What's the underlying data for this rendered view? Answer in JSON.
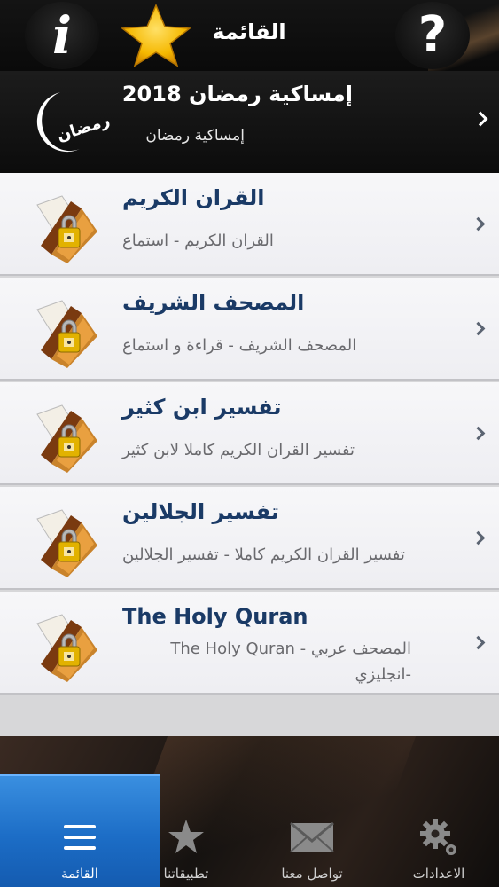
{
  "header": {
    "title": "القائمة",
    "info_icon_glyph": "i",
    "help_icon_glyph": "?",
    "star_color": "#f5b800"
  },
  "featured": {
    "title": "إمساكية رمضان 2018",
    "subtitle": "إمساكية رمضان",
    "icon": "ramadan-moon-icon",
    "icon_text": "رمضان"
  },
  "list": {
    "items": [
      {
        "title": "القران الكريم",
        "description": "القران الكريم - استماع",
        "icon": "locked-book-icon"
      },
      {
        "title": "المصحف الشريف",
        "description": "المصحف الشريف - قراءة و استماع",
        "icon": "locked-book-icon"
      },
      {
        "title": "تفسير ابن كثير",
        "description": "تفسير القران الكريم كاملا لابن كثير",
        "icon": "locked-book-icon"
      },
      {
        "title": "تفسير الجلالين",
        "description": "تفسير القران الكريم كاملا - تفسير الجلالين",
        "icon": "locked-book-icon"
      },
      {
        "title": "The Holy Quran",
        "description": "المصحف عربي - The Holy Quran -انجليزي",
        "icon": "locked-book-icon"
      }
    ]
  },
  "tabbar": {
    "tabs": [
      {
        "label": "القائمة",
        "icon": "menu-icon",
        "active": true
      },
      {
        "label": "تطبيقاتنا",
        "icon": "star-icon",
        "active": false
      },
      {
        "label": "تواصل معنا",
        "icon": "mail-icon",
        "active": false
      },
      {
        "label": "الاعدادات",
        "icon": "gear-icon",
        "active": false
      }
    ]
  },
  "colors": {
    "accent_blue": "#1c6dc6",
    "title_blue": "#1a3a66",
    "header_bg": "#111111"
  }
}
